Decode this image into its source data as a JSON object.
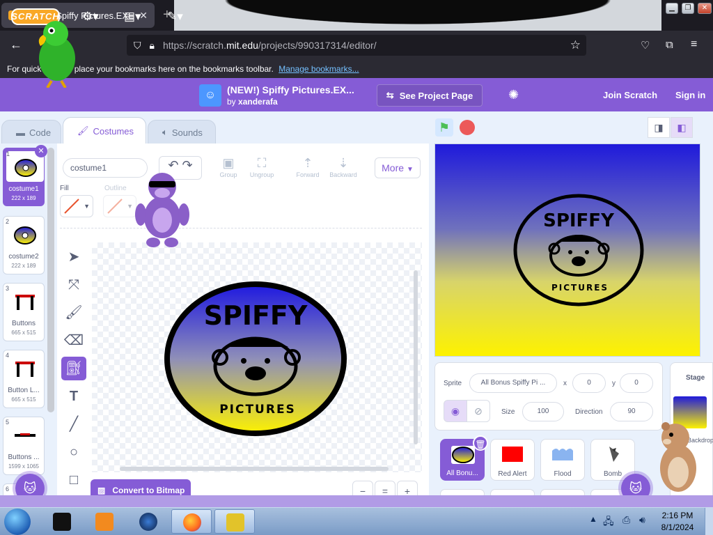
{
  "browser": {
    "tab_title": "(NEW!) Spiffy Pictures.EXE Bonus",
    "tab_close": "✕",
    "new_tab": "+",
    "url_prefix": "https://scratch.",
    "url_host": "mit.edu",
    "url_path": "/projects/990317314/editor/",
    "bookmarks_text": "For quick access, place your bookmarks here on the bookmarks toolbar.",
    "bookmarks_link": "Manage bookmarks..."
  },
  "menubar": {
    "logo": "SCRATCH",
    "project_title": "(NEW!) Spiffy Pictures.EX...",
    "by_prefix": "by",
    "author": "xanderafa",
    "see_project_page": "See Project Page",
    "join": "Join Scratch",
    "signin": "Sign in"
  },
  "editor_tabs": {
    "code": "Code",
    "costumes": "Costumes",
    "sounds": "Sounds"
  },
  "costumes": [
    {
      "num": "1",
      "name": "costume1",
      "dims": "222 x 189"
    },
    {
      "num": "2",
      "name": "costume2",
      "dims": "222 x 189"
    },
    {
      "num": "3",
      "name": "Buttons",
      "dims": "665 x 515"
    },
    {
      "num": "4",
      "name": "Button L...",
      "dims": "665 x 515"
    },
    {
      "num": "5",
      "name": "Buttons ...",
      "dims": "1599 x 1065"
    },
    {
      "num": "6",
      "name": "",
      "dims": ""
    }
  ],
  "paint": {
    "costume_name": "costume1",
    "group": "Group",
    "ungroup": "Ungroup",
    "forward": "Forward",
    "backward": "Backward",
    "more": "More",
    "fill_label": "Fill",
    "outline_label": "Outline",
    "convert": "Convert to Bitmap",
    "zoom_out": "−",
    "zoom_reset": "=",
    "zoom_in": "+"
  },
  "artwork": {
    "word_top": "SPIFFY",
    "word_bottom": "PICTURES"
  },
  "sprite_info": {
    "sprite_label": "Sprite",
    "sprite_name": "All Bonus Spiffy Pi ...",
    "x_label": "x",
    "x": "0",
    "y_label": "y",
    "y": "0",
    "size_label": "Size",
    "size": "100",
    "direction_label": "Direction",
    "direction": "90"
  },
  "sprites": [
    {
      "name": "All Bonu..."
    },
    {
      "name": "Red Alert"
    },
    {
      "name": "Flood"
    },
    {
      "name": "Bomb"
    }
  ],
  "stage_panel": {
    "title": "Stage",
    "backdrops": "Backdrops"
  },
  "taskbar": {
    "time": "2:16 PM",
    "date": "8/1/2024"
  },
  "colors": {
    "scratch_purple": "#855cd6",
    "stage_top": "#1f1adb",
    "stage_bottom": "#fdf200"
  }
}
